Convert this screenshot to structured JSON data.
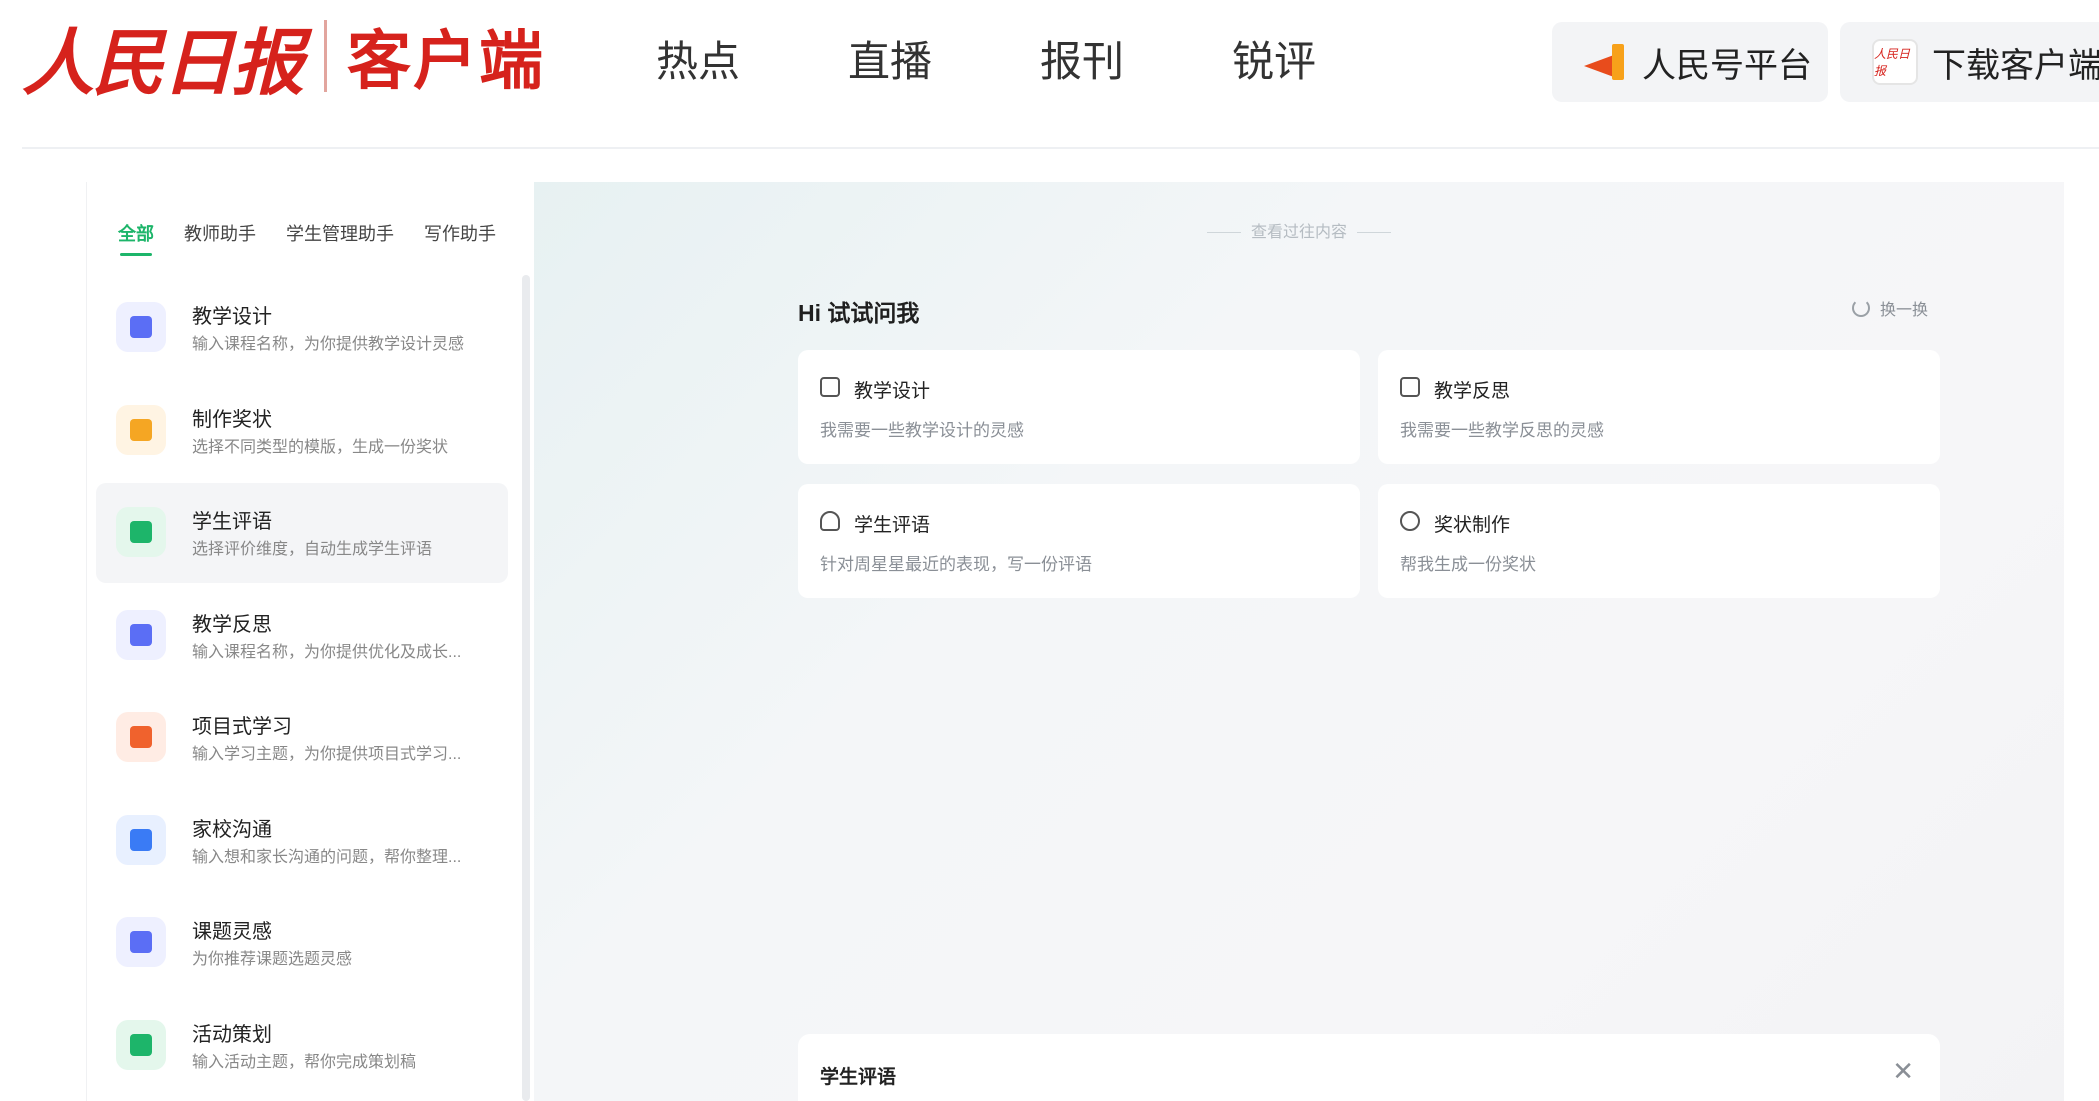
{
  "header": {
    "logo_brand": "人民日报",
    "logo_sub": "客户端",
    "nav": [
      "热点",
      "直播",
      "报刊",
      "锐评"
    ],
    "btn_platform": "人民号平台",
    "btn_download": "下载客户端",
    "app_icon_text": "人民日报"
  },
  "sidebar": {
    "tabs": [
      "全部",
      "教师助手",
      "学生管理助手",
      "写作助手"
    ],
    "active_tab": "全部",
    "items": [
      {
        "title": "教学设计",
        "desc": "输入课程名称，为你提供教学设计灵感",
        "icon": "document-icon",
        "color": "#5b6ef5",
        "bg": "#eef0ff"
      },
      {
        "title": "制作奖状",
        "desc": "选择不同类型的模版，生成一份奖状",
        "icon": "award-icon",
        "color": "#f5a623",
        "bg": "#fff4e3"
      },
      {
        "title": "学生评语",
        "desc": "选择评价维度，自动生成学生评语",
        "icon": "student-icon",
        "color": "#1db56a",
        "bg": "#e4f7ec"
      },
      {
        "title": "教学反思",
        "desc": "输入课程名称，为你提供优化及成长...",
        "icon": "reflection-icon",
        "color": "#5b6ef5",
        "bg": "#eef0ff"
      },
      {
        "title": "项目式学习",
        "desc": "输入学习主题，为你提供项目式学习...",
        "icon": "project-icon",
        "color": "#f0622d",
        "bg": "#ffece4"
      },
      {
        "title": "家校沟通",
        "desc": "输入想和家长沟通的问题，帮你整理...",
        "icon": "chat-icon",
        "color": "#3a7bf5",
        "bg": "#e8f0ff"
      },
      {
        "title": "课题灵感",
        "desc": "为你推荐课题选题灵感",
        "icon": "bulb-icon",
        "color": "#5b6ef5",
        "bg": "#eef0ff"
      },
      {
        "title": "活动策划",
        "desc": "输入活动主题，帮你完成策划稿",
        "icon": "flag-icon",
        "color": "#1db56a",
        "bg": "#e4f7ec"
      }
    ],
    "active_item": "学生评语"
  },
  "main": {
    "history_label": "查看过往内容",
    "hi_title": "Hi 试试问我",
    "refresh_label": "换一换",
    "cards": [
      {
        "title": "教学设计",
        "desc": "我需要一些教学设计的灵感",
        "icon": "document-icon"
      },
      {
        "title": "教学反思",
        "desc": "我需要一些教学反思的灵感",
        "icon": "reflection-icon"
      },
      {
        "title": "学生评语",
        "desc": "针对周星星最近的表现，写一份评语",
        "icon": "person-icon"
      },
      {
        "title": "奖状制作",
        "desc": "帮我生成一份奖状",
        "icon": "award-icon"
      }
    ],
    "bottom_panel_title": "学生评语"
  }
}
